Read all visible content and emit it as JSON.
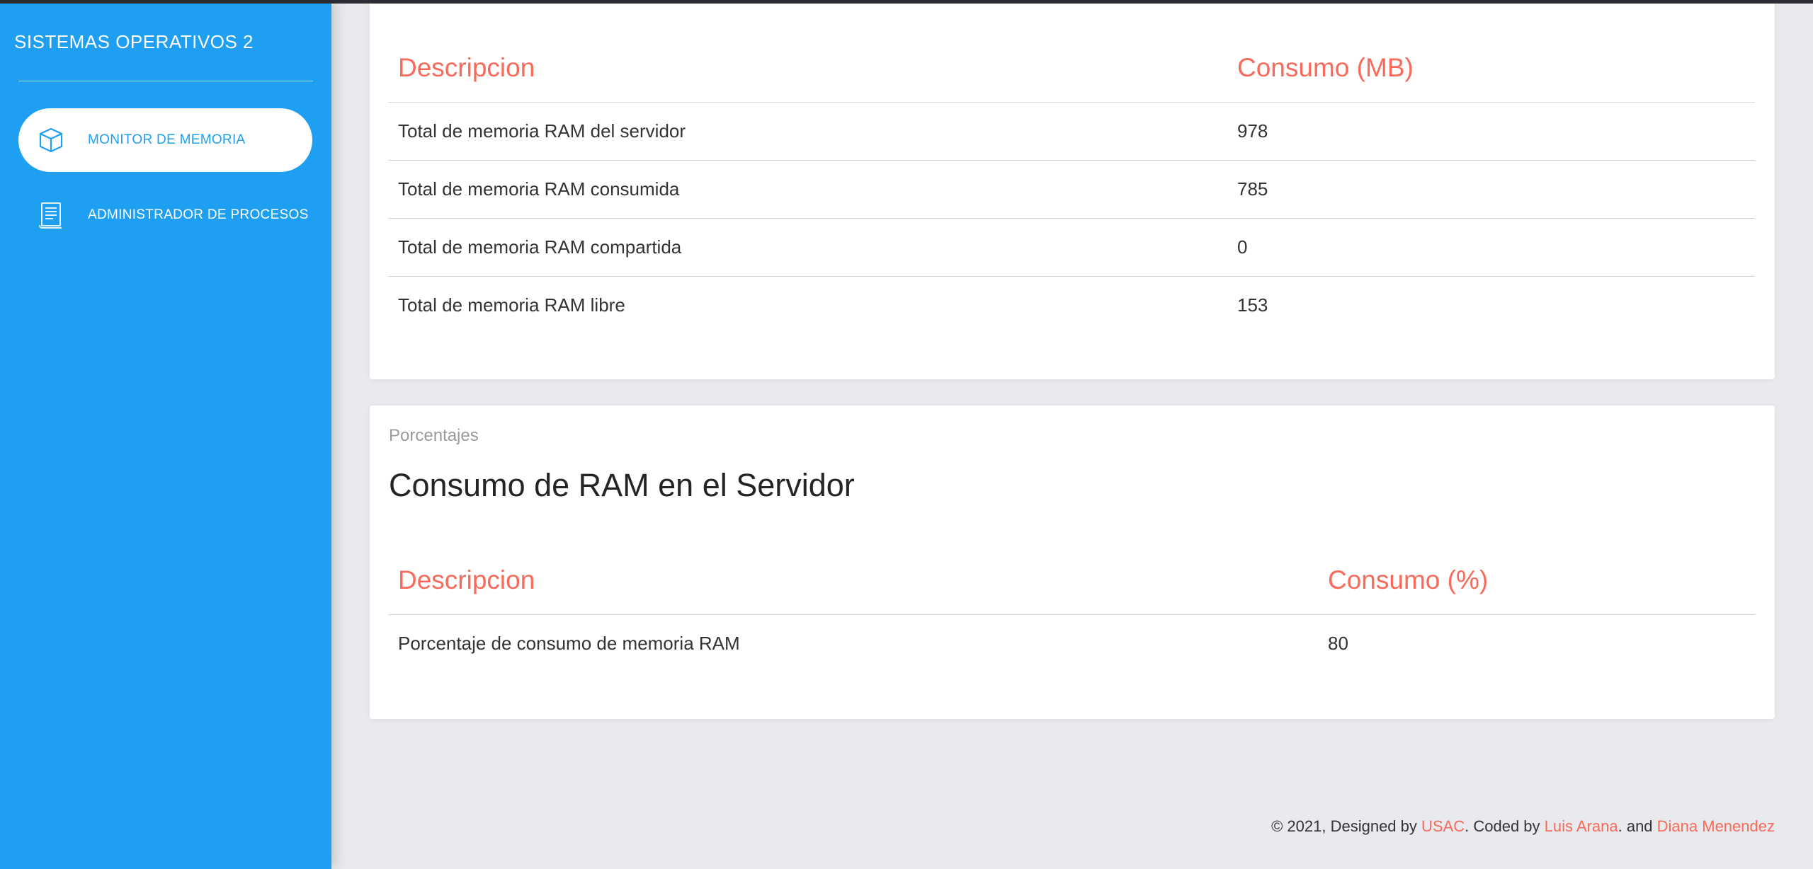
{
  "brand": {
    "title": "SISTEMAS OPERATIVOS 2"
  },
  "sidebar": {
    "items": [
      {
        "label": "MONITOR DE MEMORIA",
        "icon": "box-icon",
        "active": true
      },
      {
        "label": "ADMINISTRADOR DE PROCESOS",
        "icon": "document-icon",
        "active": false
      }
    ]
  },
  "memory_table": {
    "headers": [
      "Descripcion",
      "Consumo (MB)"
    ],
    "rows": [
      {
        "description": "Total de memoria RAM del servidor",
        "value": "978"
      },
      {
        "description": "Total de memoria RAM consumida",
        "value": "785"
      },
      {
        "description": "Total de memoria RAM compartida",
        "value": "0"
      },
      {
        "description": "Total de memoria RAM libre",
        "value": "153"
      }
    ]
  },
  "percent_card": {
    "category": "Porcentajes",
    "title": "Consumo de RAM en el Servidor",
    "headers": [
      "Descripcion",
      "Consumo (%)"
    ],
    "rows": [
      {
        "description": "Porcentaje de consumo de memoria RAM",
        "value": "80"
      }
    ]
  },
  "footer": {
    "prefix": "© 2021, Designed by ",
    "designer": "USAC",
    "middle": ". Coded by ",
    "author1": "Luis Arana",
    "joiner": ". and ",
    "author2": "Diana Menendez"
  },
  "colors": {
    "sidebar": "#1e9ff2",
    "accent": "#f96a5a",
    "background": "#e9eaee"
  }
}
